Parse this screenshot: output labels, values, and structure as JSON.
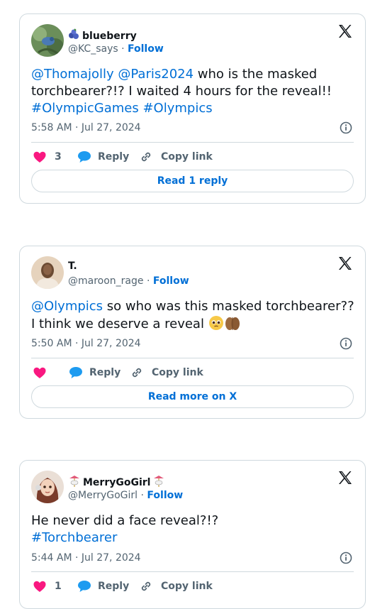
{
  "tweets": [
    {
      "display_name": "blueberry",
      "name_prefix_icon": "blueberry-emoji",
      "handle": "@KC_says",
      "separator": " · ",
      "follow_label": "Follow",
      "text_parts": [
        "@Thomajolly",
        " ",
        "@Paris2024",
        " who is the masked torchbearer?!? I waited 4 hours for the reveal!! ",
        "#OlympicGames",
        " ",
        "#Olympics"
      ],
      "timestamp": "5:58 AM · Jul 27, 2024",
      "like_count": "3",
      "reply_label": "Reply",
      "copy_link_label": "Copy link",
      "bottom_button": "Read 1 reply"
    },
    {
      "display_name": "T.",
      "handle": "@maroon_rage",
      "separator": " · ",
      "follow_label": "Follow",
      "text_parts": [
        "@Olympics",
        " so who was this masked torchbearer?? I think we deserve a reveal "
      ],
      "emojis": [
        "pleading-face-emoji",
        "folded-hands-emoji"
      ],
      "timestamp": "5:50 AM · Jul 27, 2024",
      "like_count": "",
      "reply_label": "Reply",
      "copy_link_label": "Copy link",
      "bottom_button": "Read more on X"
    },
    {
      "display_name": "MerryGoGirl",
      "name_decor_icon": "carousel-horse-emoji",
      "handle": "@MerryGoGirl",
      "separator": " · ",
      "follow_label": "Follow",
      "text_parts": [
        "He never did a face reveal?!?",
        "#Torchbearer"
      ],
      "timestamp": "5:44 AM · Jul 27, 2024",
      "like_count": "1",
      "reply_label": "Reply",
      "copy_link_label": "Copy link"
    }
  ],
  "colors": {
    "link": "#006fd6",
    "heart": "#f91880",
    "reply_bubble": "#1d9bf0",
    "secondary_text": "#536471",
    "border": "#cfd9de"
  },
  "icons": [
    "x-logo-icon",
    "info-icon",
    "heart-icon",
    "reply-bubble-icon",
    "link-icon"
  ]
}
